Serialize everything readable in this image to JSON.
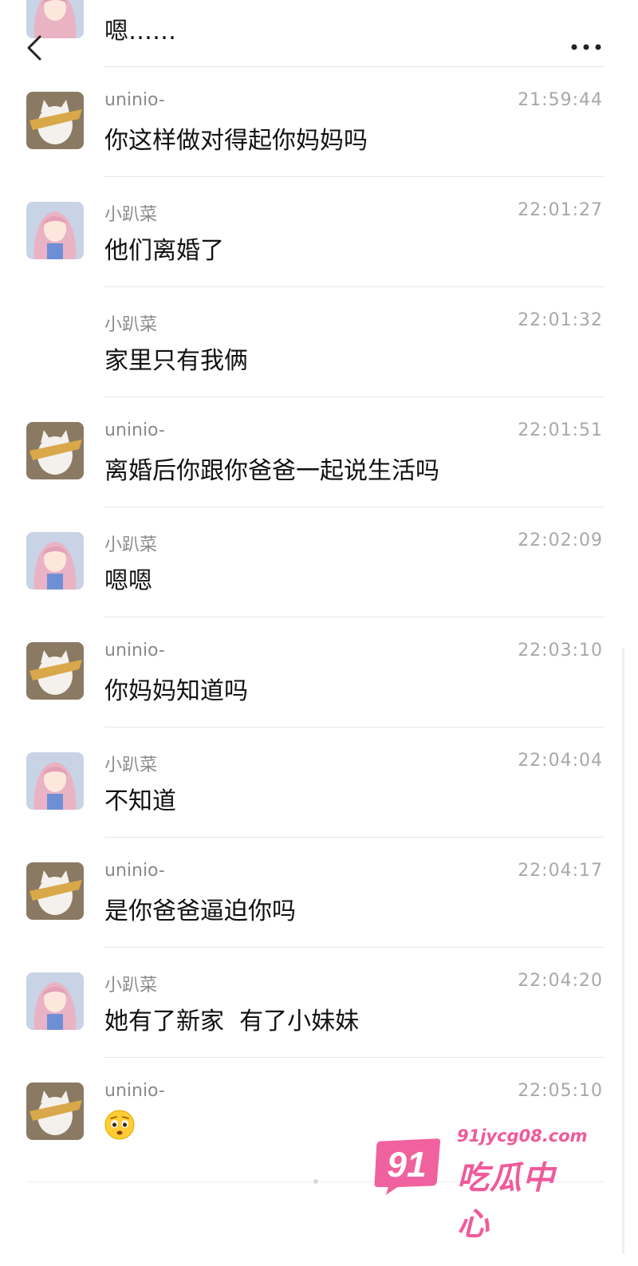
{
  "header": {
    "partial_message": "嗯……",
    "back_icon": "chevron-left-icon",
    "more_icon": "more-horizontal-icon"
  },
  "users": {
    "uninio": {
      "name": "uninio-",
      "avatar": "cat-avatar"
    },
    "xiaopacai": {
      "name": "小趴菜",
      "avatar": "anime-girl-avatar"
    }
  },
  "messages": [
    {
      "sender": "uninio-",
      "time": "21:59:44",
      "text": "你这样做对得起你妈妈吗",
      "show_avatar": true
    },
    {
      "sender": "小趴菜",
      "time": "22:01:27",
      "text": "他们离婚了",
      "show_avatar": true
    },
    {
      "sender": "小趴菜",
      "time": "22:01:32",
      "text": "家里只有我俩",
      "show_avatar": false
    },
    {
      "sender": "uninio-",
      "time": "22:01:51",
      "text": "离婚后你跟你爸爸一起说生活吗",
      "show_avatar": true
    },
    {
      "sender": "小趴菜",
      "time": "22:02:09",
      "text": "嗯嗯",
      "show_avatar": true
    },
    {
      "sender": "uninio-",
      "time": "22:03:10",
      "text": "你妈妈知道吗",
      "show_avatar": true
    },
    {
      "sender": "小趴菜",
      "time": "22:04:04",
      "text": "不知道",
      "show_avatar": true
    },
    {
      "sender": "uninio-",
      "time": "22:04:17",
      "text": "是你爸爸逼迫你吗",
      "show_avatar": true
    },
    {
      "sender": "小趴菜",
      "time": "22:04:20",
      "text": "她有了新家  有了小妹妹",
      "show_avatar": true
    },
    {
      "sender": "uninio-",
      "time": "22:05:10",
      "text": "",
      "emoji": "worried-face-emoji",
      "show_avatar": true
    }
  ],
  "watermark": {
    "badge": "91",
    "url": "91jycg08.com",
    "title": "吃瓜中心",
    "color": "#f05a9a"
  }
}
